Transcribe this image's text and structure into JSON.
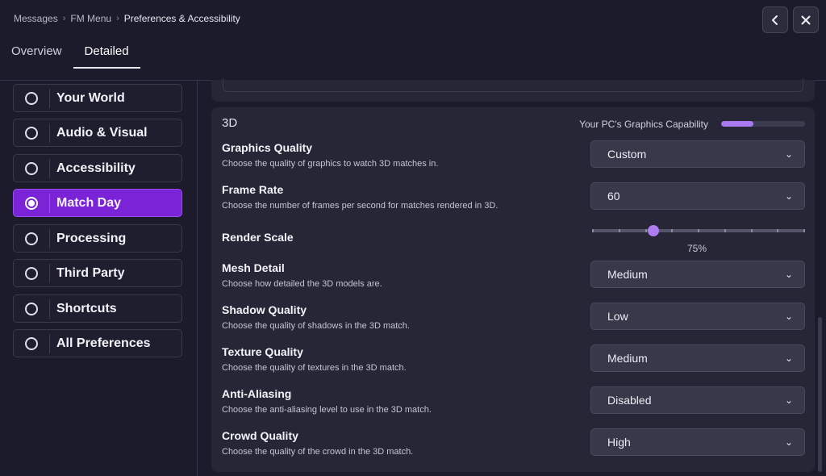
{
  "breadcrumb": {
    "items": [
      "Messages",
      "FM Menu",
      "Preferences & Accessibility"
    ]
  },
  "header": {
    "back_icon": "chevron-left-icon",
    "close_icon": "close-icon"
  },
  "tabs": [
    {
      "label": "Overview",
      "active": false
    },
    {
      "label": "Detailed",
      "active": true
    }
  ],
  "sidebar": {
    "items": [
      {
        "label": "Your World",
        "active": false
      },
      {
        "label": "Audio & Visual",
        "active": false
      },
      {
        "label": "Accessibility",
        "active": false
      },
      {
        "label": "Match Day",
        "active": true
      },
      {
        "label": "Processing",
        "active": false
      },
      {
        "label": "Third Party",
        "active": false
      },
      {
        "label": "Shortcuts",
        "active": false
      },
      {
        "label": "All Preferences",
        "active": false
      }
    ]
  },
  "section": {
    "title": "3D",
    "capability_label": "Your PC's Graphics Capability",
    "capability_level": 0.38,
    "settings": [
      {
        "title": "Graphics Quality",
        "description": "Choose the quality of graphics to watch 3D matches in.",
        "value": "Custom"
      },
      {
        "title": "Frame Rate",
        "description": "Choose the number of frames per second for matches rendered in 3D.",
        "value": "60"
      },
      {
        "title": "Render Scale",
        "slider_value": "75%",
        "slider_fraction": 0.29
      },
      {
        "title": "Mesh Detail",
        "description": "Choose how detailed the 3D models are.",
        "value": "Medium"
      },
      {
        "title": "Shadow Quality",
        "description": "Choose the quality of shadows in the 3D match.",
        "value": "Low"
      },
      {
        "title": "Texture Quality",
        "description": "Choose the quality of textures in the 3D match.",
        "value": "Medium"
      },
      {
        "title": "Anti-Aliasing",
        "description": "Choose the anti-aliasing level to use in the 3D match.",
        "value": "Disabled"
      },
      {
        "title": "Crowd Quality",
        "description": "Choose the quality of the crowd in the 3D match.",
        "value": "High"
      }
    ]
  },
  "colors": {
    "accent": "#7b23d6",
    "capability_fill": "#a879f0",
    "background": "#1c1b2b"
  }
}
